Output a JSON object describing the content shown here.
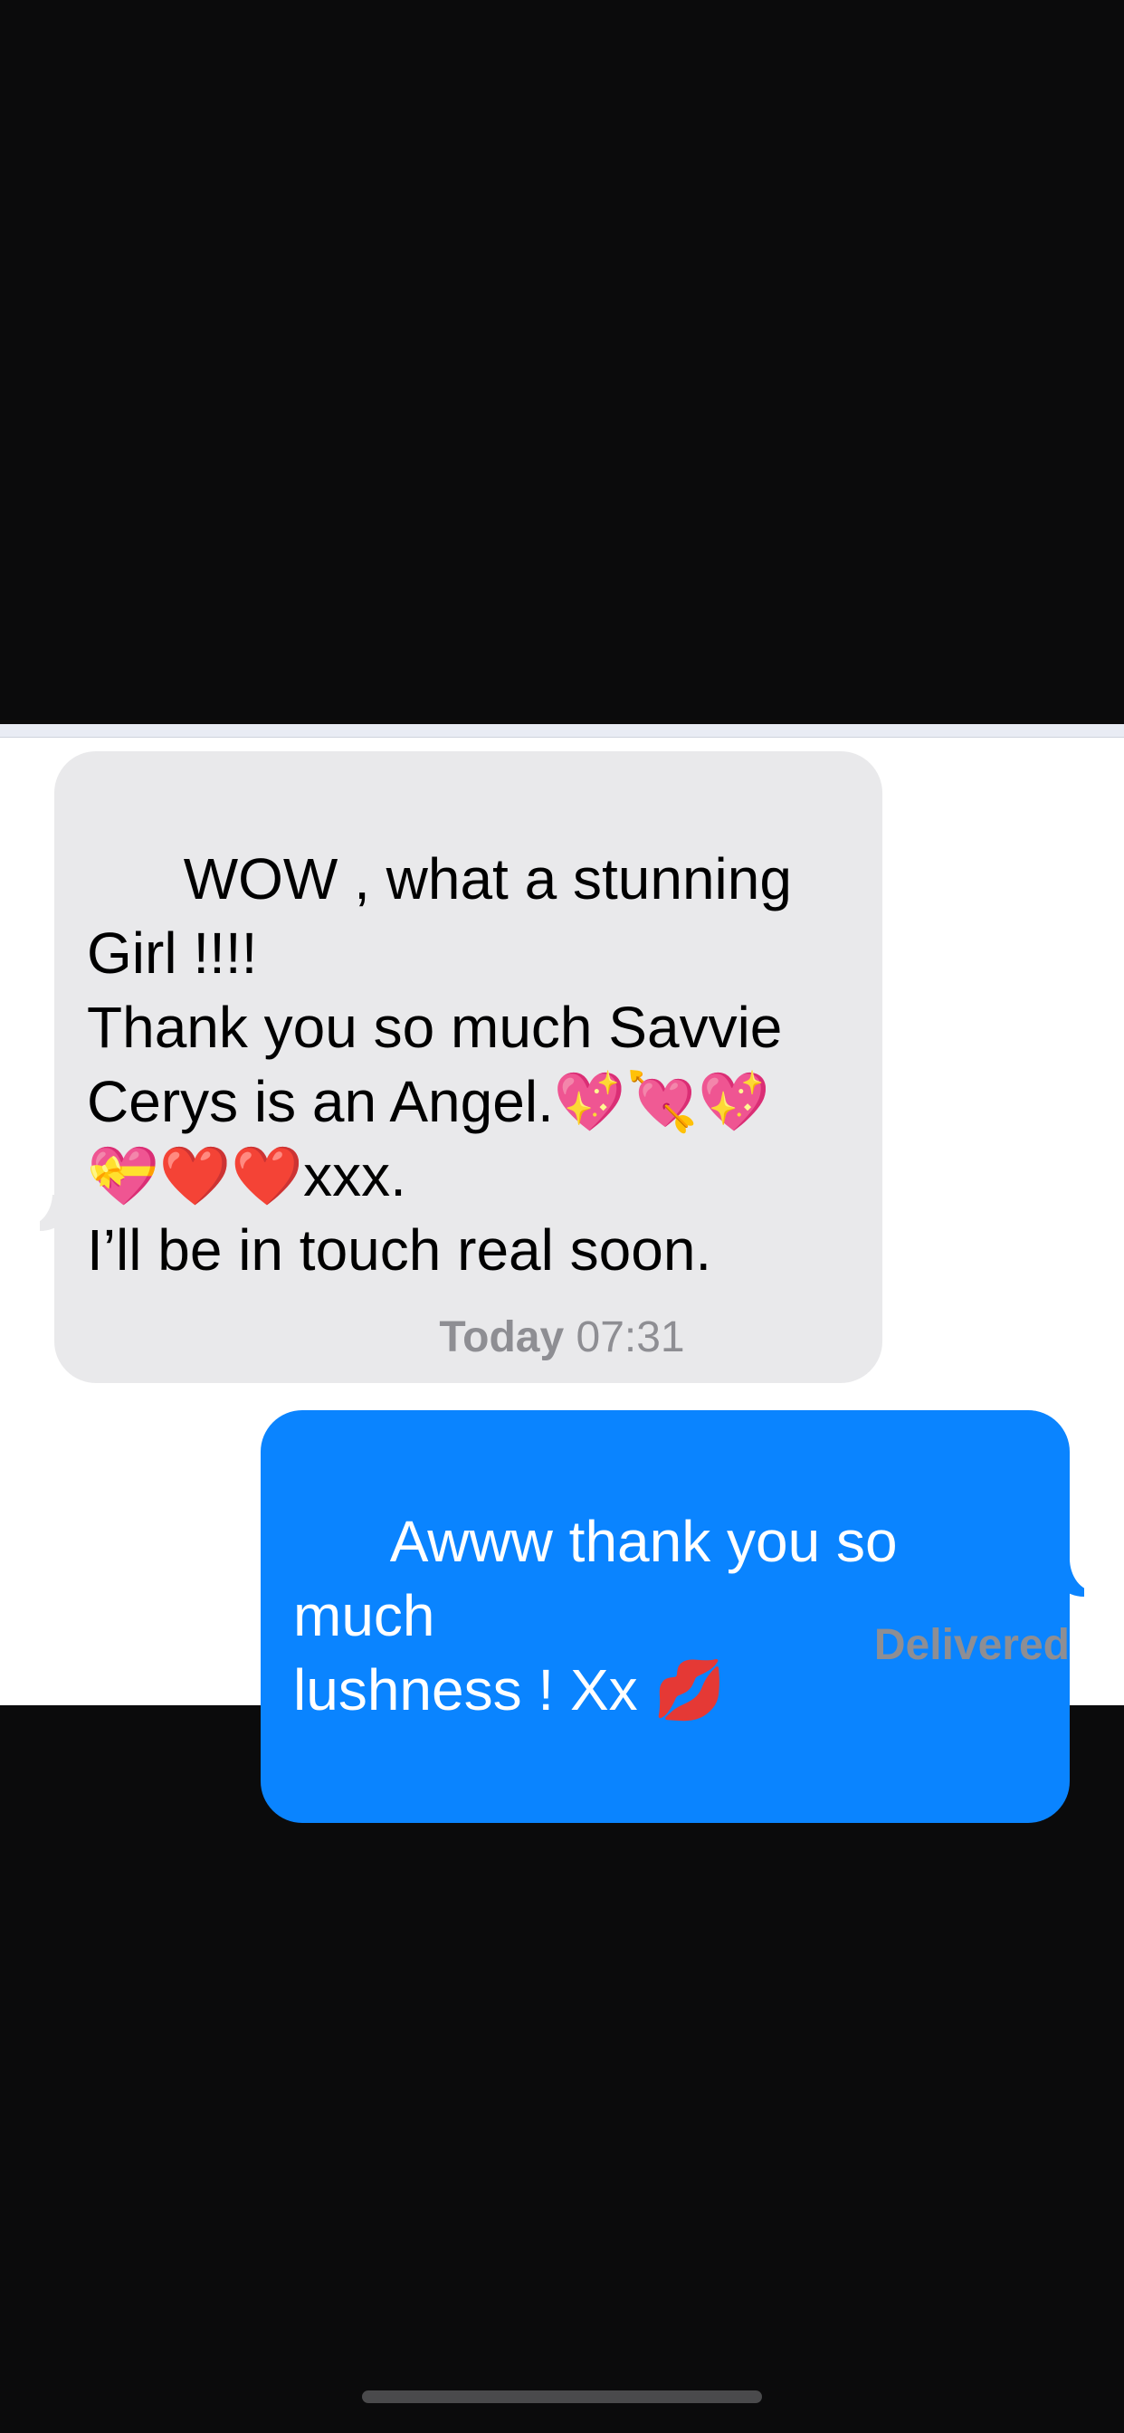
{
  "messages": {
    "incoming": {
      "text": "WOW , what a stunning\nGirl !!!!\nThank you so much Savvie\nCerys is an Angel.💖💘💖\n💝❤️❤️xxx.\nI’ll be in touch real soon."
    },
    "timestamp": {
      "day": "Today",
      "time": "07:31"
    },
    "outgoing": {
      "text": "Awww thank you so much\nlushness ! Xx 💋"
    },
    "status": "Delivered"
  },
  "colors": {
    "incoming_bubble": "#e9e9eb",
    "outgoing_bubble": "#0a84ff",
    "meta_text": "#8e8e93",
    "background": "#0b0b0c"
  }
}
